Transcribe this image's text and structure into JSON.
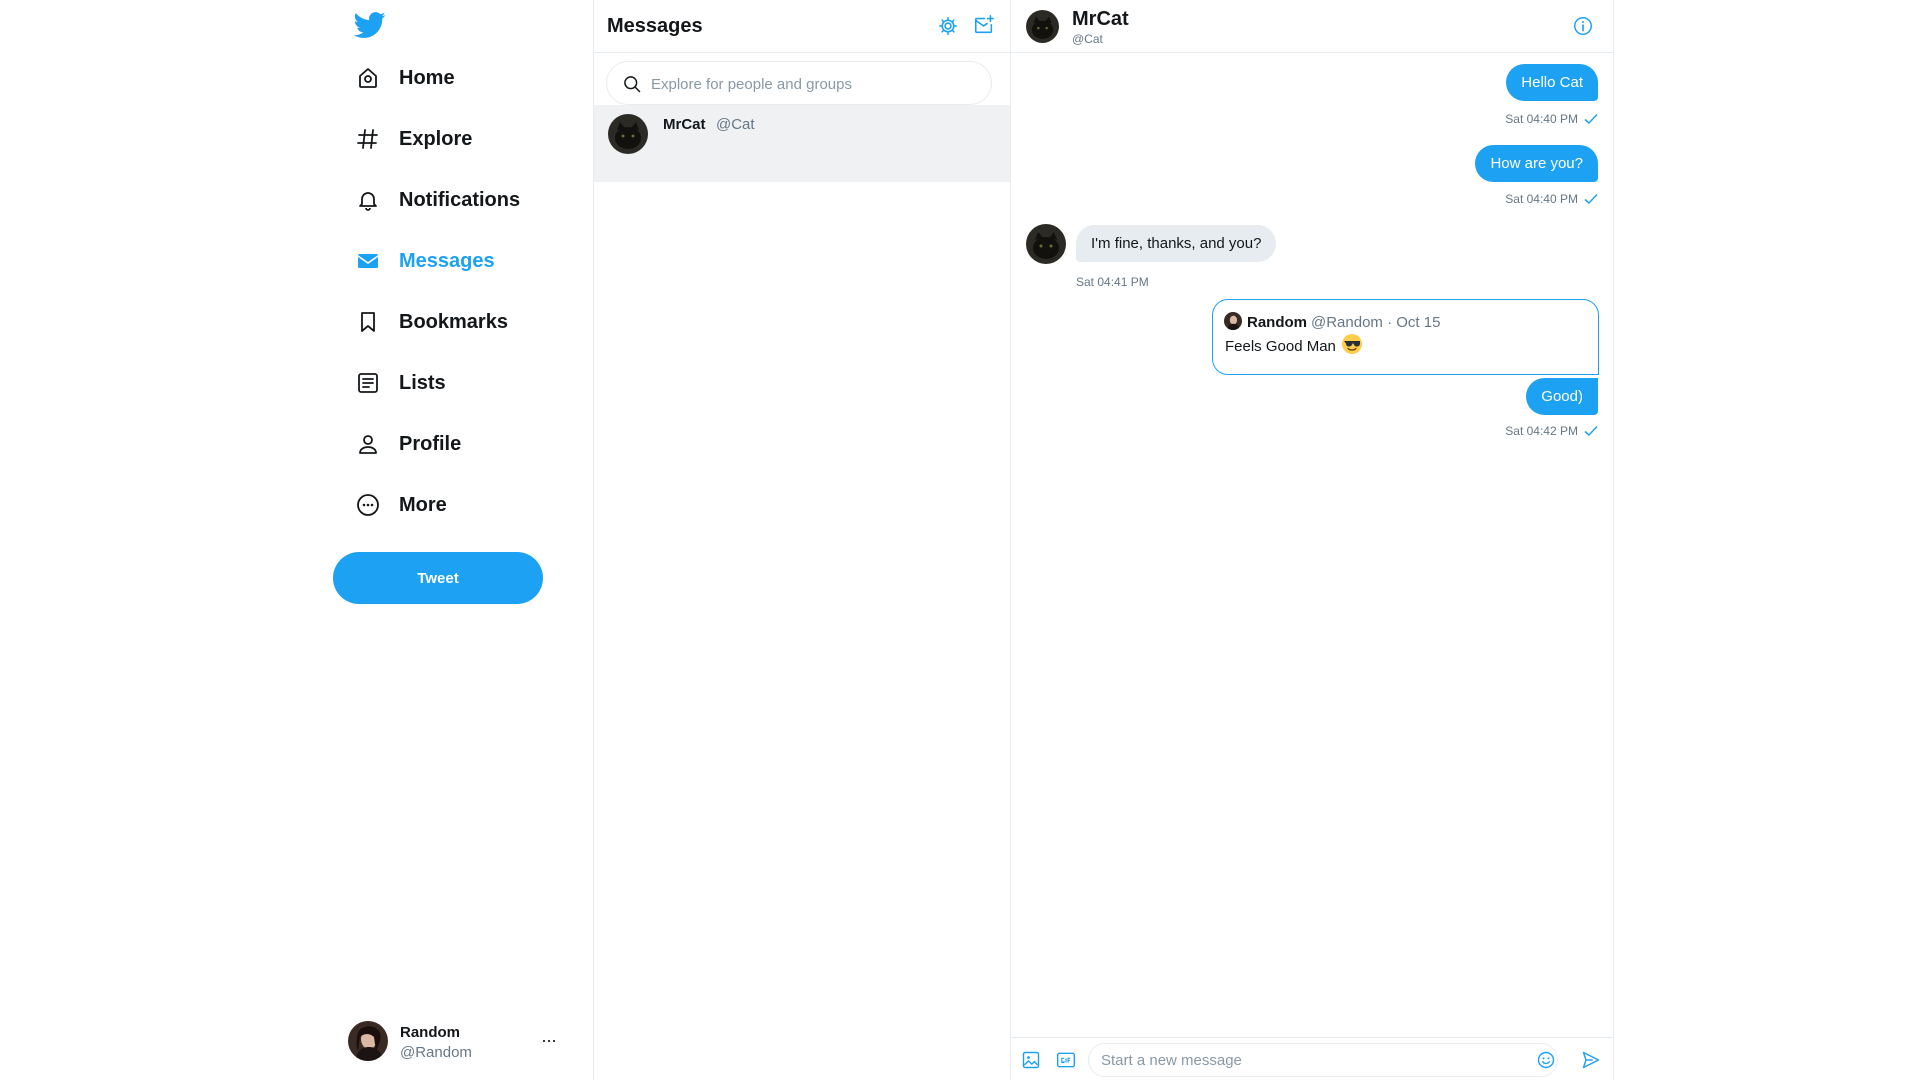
{
  "colors": {
    "accent": "#1da1f2",
    "text": "#14171a",
    "muted": "#657786",
    "border": "#e6ecf0",
    "selected_bg": "#f0f1f3"
  },
  "nav": {
    "logo_icon": "twitter-bird-icon",
    "items": [
      {
        "label": "Home",
        "icon": "home-icon"
      },
      {
        "label": "Explore",
        "icon": "hashtag-icon"
      },
      {
        "label": "Notifications",
        "icon": "bell-icon"
      },
      {
        "label": "Messages",
        "icon": "envelope-icon",
        "active": true
      },
      {
        "label": "Bookmarks",
        "icon": "bookmark-icon"
      },
      {
        "label": "Lists",
        "icon": "list-icon"
      },
      {
        "label": "Profile",
        "icon": "person-icon"
      },
      {
        "label": "More",
        "icon": "more-circle-icon"
      }
    ],
    "tweet_label": "Tweet",
    "account": {
      "name": "Random",
      "handle": "@Random",
      "more": "···"
    }
  },
  "messages_list": {
    "title": "Messages",
    "search_placeholder": "Explore for people and groups",
    "conversations": [
      {
        "name": "MrCat",
        "handle": "@Cat"
      }
    ]
  },
  "chat": {
    "name": "MrCat",
    "handle": "@Cat",
    "messages": [
      {
        "direction": "out",
        "text": "Hello Cat",
        "time": "Sat 04:40 PM"
      },
      {
        "direction": "out",
        "text": "How are you?",
        "time": "Sat 04:40 PM"
      },
      {
        "direction": "in",
        "text": "I'm fine, thanks, and you?",
        "time": "Sat 04:41 PM"
      },
      {
        "direction": "out",
        "text": "Good)",
        "time": "Sat 04:42 PM",
        "quoted_tweet": {
          "name": "Random",
          "handle": "@Random · Oct 15",
          "text": "Feels Good Man",
          "emoji": "sunglasses-emoji"
        }
      }
    ],
    "composer_placeholder": "Start a new message"
  }
}
